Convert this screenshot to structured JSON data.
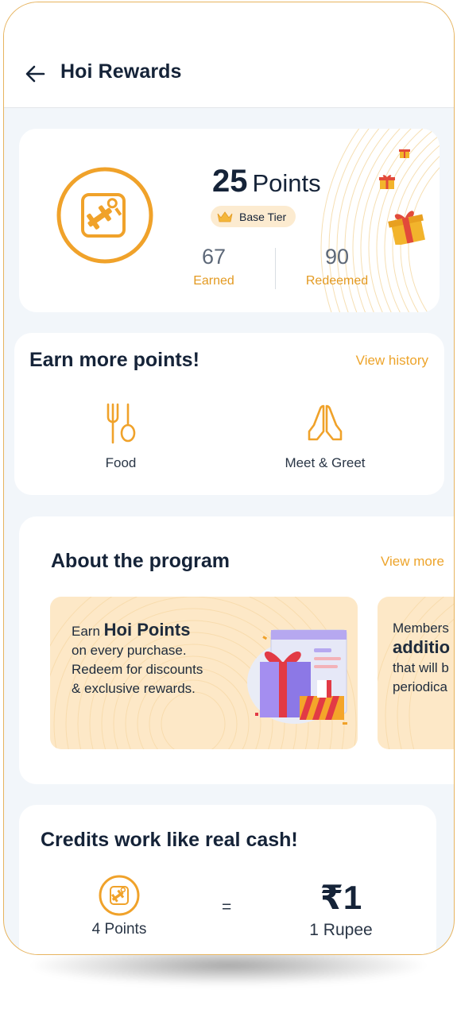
{
  "app": {
    "title": "Hoi Rewards",
    "colors": {
      "accent": "#F0A22A",
      "text": "#152338",
      "background": "#F2F6FA"
    }
  },
  "points_card": {
    "logo_icon": "hoi-logo-icon",
    "points_value": "25",
    "points_label": "Points",
    "tier_icon": "crown-icon",
    "tier_label": "Base Tier",
    "earned": {
      "value": "67",
      "label": "Earned"
    },
    "redeemed": {
      "value": "90",
      "label": "Redeemed"
    }
  },
  "earn": {
    "title": "Earn more points!",
    "link": "View history",
    "categories": [
      {
        "icon": "fork-spoon-icon",
        "label": "Food"
      },
      {
        "icon": "folded-hands-icon",
        "label": "Meet & Greet"
      }
    ]
  },
  "about": {
    "title": "About the program",
    "link": "View more",
    "promos": [
      {
        "line1_prefix": "Earn",
        "line1_bold": "Hoi Points",
        "line2": "on every purchase.",
        "line3": "Redeem for discounts",
        "line4": "& exclusive rewards."
      },
      {
        "line1": "Members",
        "line2_bold": "additio",
        "line3": "that will b",
        "line4": "periodica"
      }
    ]
  },
  "credits": {
    "title": "Credits work like real cash!",
    "points_label": "4 Points",
    "equals": "=",
    "rupee_value": "₹1",
    "rupee_label": "1 Rupee"
  }
}
